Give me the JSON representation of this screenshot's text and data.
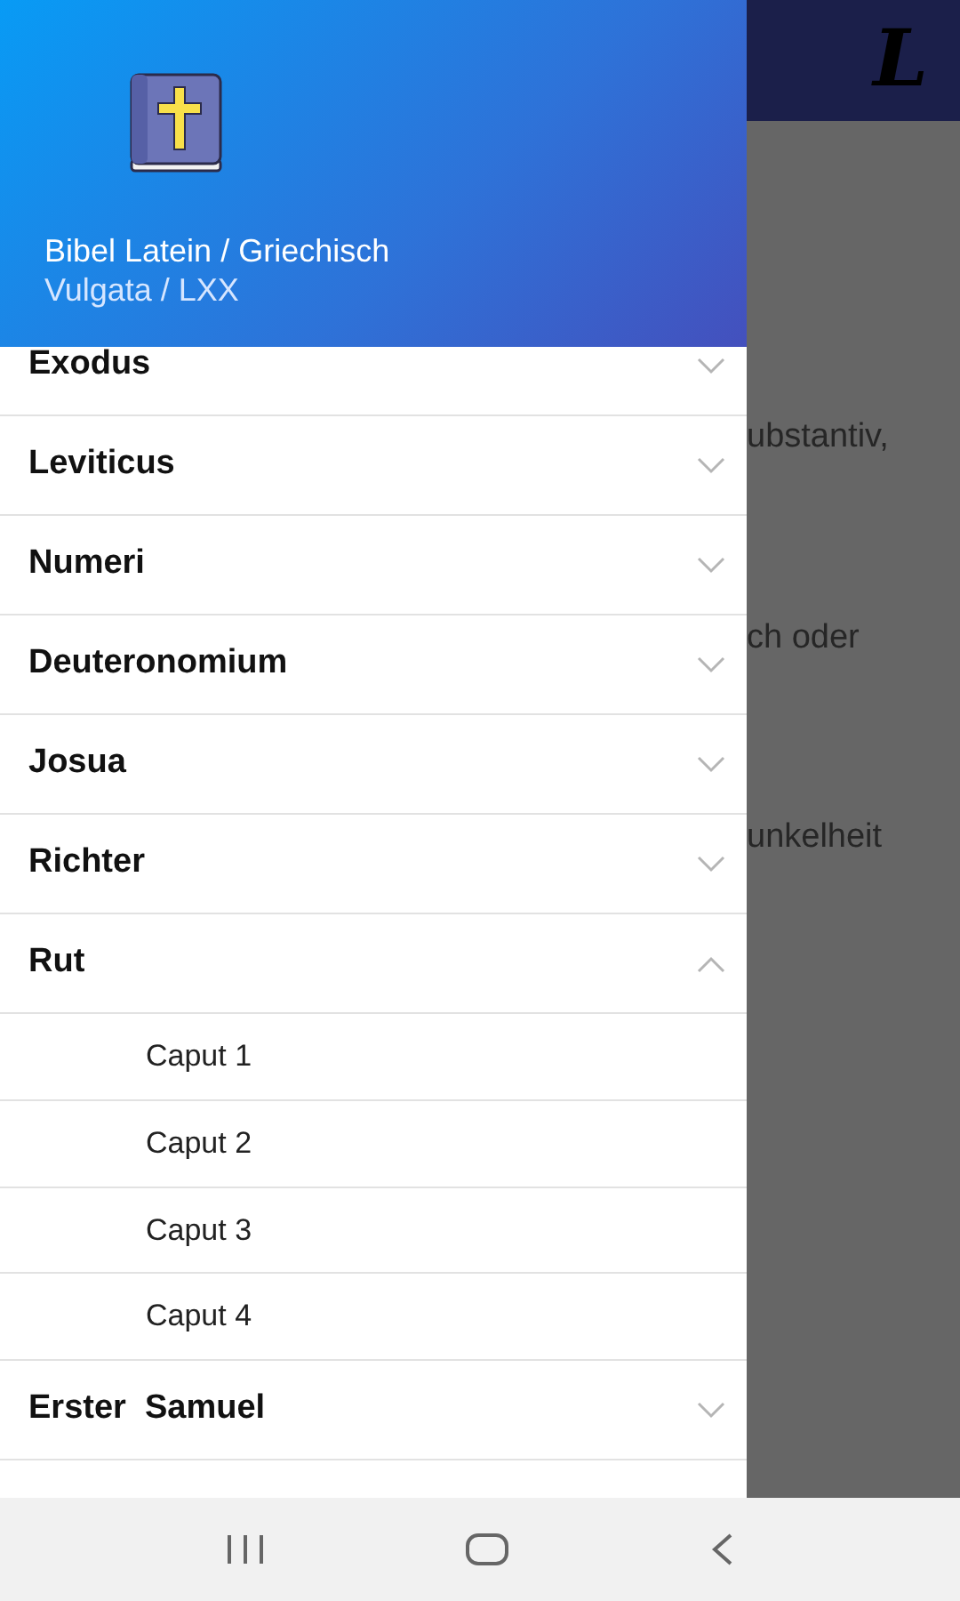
{
  "app_bar": {
    "logo": "L"
  },
  "content": {
    "lines": [
      "ubstantiv,",
      "ch oder",
      "unkelheit"
    ]
  },
  "drawer": {
    "title": "Bibel Latein / Griechisch",
    "subtitle": "Vulgata / LXX",
    "books": [
      {
        "name": "Exodus",
        "expanded": false
      },
      {
        "name": "Leviticus",
        "expanded": false
      },
      {
        "name": "Numeri",
        "expanded": false
      },
      {
        "name": "Deuteronomium",
        "expanded": false
      },
      {
        "name": "Josua",
        "expanded": false
      },
      {
        "name": "Richter",
        "expanded": false
      },
      {
        "name": "Rut",
        "expanded": true,
        "chapters": [
          "Caput 1",
          "Caput 2",
          "Caput 3",
          "Caput 4"
        ]
      },
      {
        "name": "Erster  Samuel",
        "expanded": false
      }
    ]
  }
}
